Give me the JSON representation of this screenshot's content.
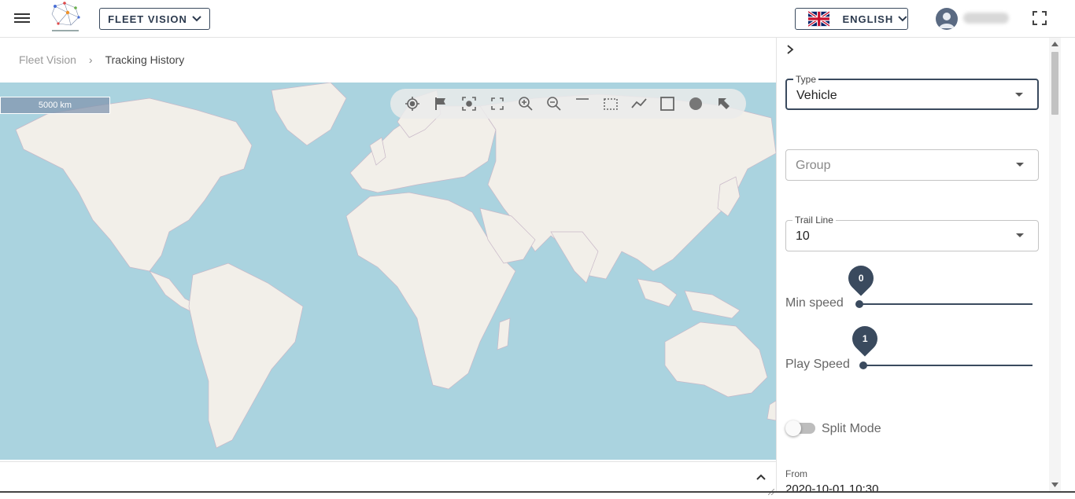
{
  "header": {
    "app_selector": "FLEET VISION",
    "language": "ENGLISH"
  },
  "breadcrumb": {
    "items": [
      "Fleet Vision",
      "Tracking History"
    ],
    "separator": "›"
  },
  "map": {
    "scale_label": "5000 km",
    "toolbar_icons": [
      "locate-icon",
      "flag-icon",
      "focus-icon",
      "fullscreen-icon",
      "zoom-in-icon",
      "zoom-out-icon",
      "line-icon",
      "box-select-icon",
      "polyline-icon",
      "rectangle-icon",
      "circle-icon",
      "pointer-icon"
    ]
  },
  "filters": {
    "type": {
      "label": "Type",
      "value": "Vehicle"
    },
    "group": {
      "placeholder": "Group"
    },
    "trail_line": {
      "label": "Trail Line",
      "value": "10"
    },
    "min_speed": {
      "label": "Min speed",
      "value": "0",
      "level": 0
    },
    "play_speed": {
      "label": "Play Speed",
      "value": "1",
      "level": 0.02
    },
    "split_mode": {
      "label": "Split Mode",
      "on": false
    },
    "from": {
      "label": "From",
      "value": "2020-10-01 10:30"
    }
  },
  "colors": {
    "accent": "#3a4a5e",
    "ocean": "#aad3df",
    "land": "#f2efe9"
  }
}
